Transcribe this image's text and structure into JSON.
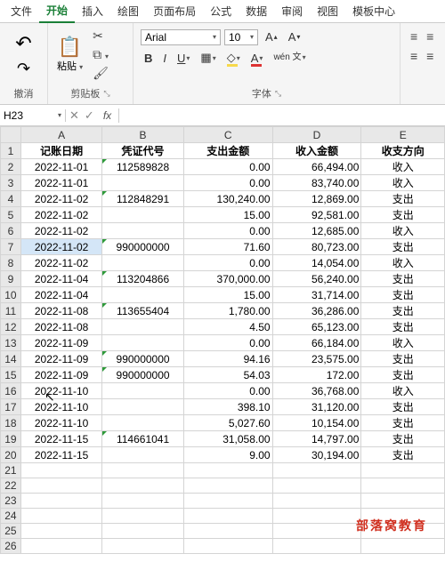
{
  "tabs": [
    "文件",
    "开始",
    "插入",
    "绘图",
    "页面布局",
    "公式",
    "数据",
    "审阅",
    "视图",
    "模板中心"
  ],
  "active_tab_index": 1,
  "ribbon": {
    "undo_label": "撤消",
    "paste_label": "粘贴",
    "clipboard_label": "剪贴板",
    "font_label": "字体",
    "font_name": "Arial",
    "font_size": "10",
    "wen_label": "wén\n文"
  },
  "namebox": {
    "cell_ref": "H23",
    "fx": "fx"
  },
  "columns": [
    "A",
    "B",
    "C",
    "D",
    "E"
  ],
  "headers": [
    "记账日期",
    "凭证代号",
    "支出金额",
    "收入金额",
    "收支方向"
  ],
  "rows": [
    {
      "d": "2022-11-01",
      "c": "112589828",
      "tri": true,
      "out": "0.00",
      "in": "66,494.00",
      "dir": "收入"
    },
    {
      "d": "2022-11-01",
      "c": "",
      "tri": false,
      "out": "0.00",
      "in": "83,740.00",
      "dir": "收入"
    },
    {
      "d": "2022-11-02",
      "c": "112848291",
      "tri": true,
      "out": "130,240.00",
      "in": "12,869.00",
      "dir": "支出"
    },
    {
      "d": "2022-11-02",
      "c": "",
      "tri": false,
      "out": "15.00",
      "in": "92,581.00",
      "dir": "支出"
    },
    {
      "d": "2022-11-02",
      "c": "",
      "tri": false,
      "out": "0.00",
      "in": "12,685.00",
      "dir": "收入"
    },
    {
      "d": "2022-11-02",
      "c": "990000000",
      "tri": true,
      "out": "71.60",
      "in": "80,723.00",
      "dir": "支出"
    },
    {
      "d": "2022-11-02",
      "c": "",
      "tri": false,
      "out": "0.00",
      "in": "14,054.00",
      "dir": "收入"
    },
    {
      "d": "2022-11-04",
      "c": "113204866",
      "tri": true,
      "out": "370,000.00",
      "in": "56,240.00",
      "dir": "支出"
    },
    {
      "d": "2022-11-04",
      "c": "",
      "tri": false,
      "out": "15.00",
      "in": "31,714.00",
      "dir": "支出"
    },
    {
      "d": "2022-11-08",
      "c": "113655404",
      "tri": true,
      "out": "1,780.00",
      "in": "36,286.00",
      "dir": "支出"
    },
    {
      "d": "2022-11-08",
      "c": "",
      "tri": false,
      "out": "4.50",
      "in": "65,123.00",
      "dir": "支出"
    },
    {
      "d": "2022-11-09",
      "c": "",
      "tri": false,
      "out": "0.00",
      "in": "66,184.00",
      "dir": "收入"
    },
    {
      "d": "2022-11-09",
      "c": "990000000",
      "tri": true,
      "out": "94.16",
      "in": "23,575.00",
      "dir": "支出"
    },
    {
      "d": "2022-11-09",
      "c": "990000000",
      "tri": true,
      "out": "54.03",
      "in": "172.00",
      "dir": "支出"
    },
    {
      "d": "2022-11-10",
      "c": "",
      "tri": false,
      "out": "0.00",
      "in": "36,768.00",
      "dir": "收入"
    },
    {
      "d": "2022-11-10",
      "c": "",
      "tri": false,
      "out": "398.10",
      "in": "31,120.00",
      "dir": "支出"
    },
    {
      "d": "2022-11-10",
      "c": "",
      "tri": false,
      "out": "5,027.60",
      "in": "10,154.00",
      "dir": "支出"
    },
    {
      "d": "2022-11-15",
      "c": "114661041",
      "tri": true,
      "out": "31,058.00",
      "in": "14,797.00",
      "dir": "支出"
    },
    {
      "d": "2022-11-15",
      "c": "",
      "tri": false,
      "out": "9.00",
      "in": "30,194.00",
      "dir": "支出"
    }
  ],
  "blank_rows": 6,
  "watermark": "部落窝教育"
}
